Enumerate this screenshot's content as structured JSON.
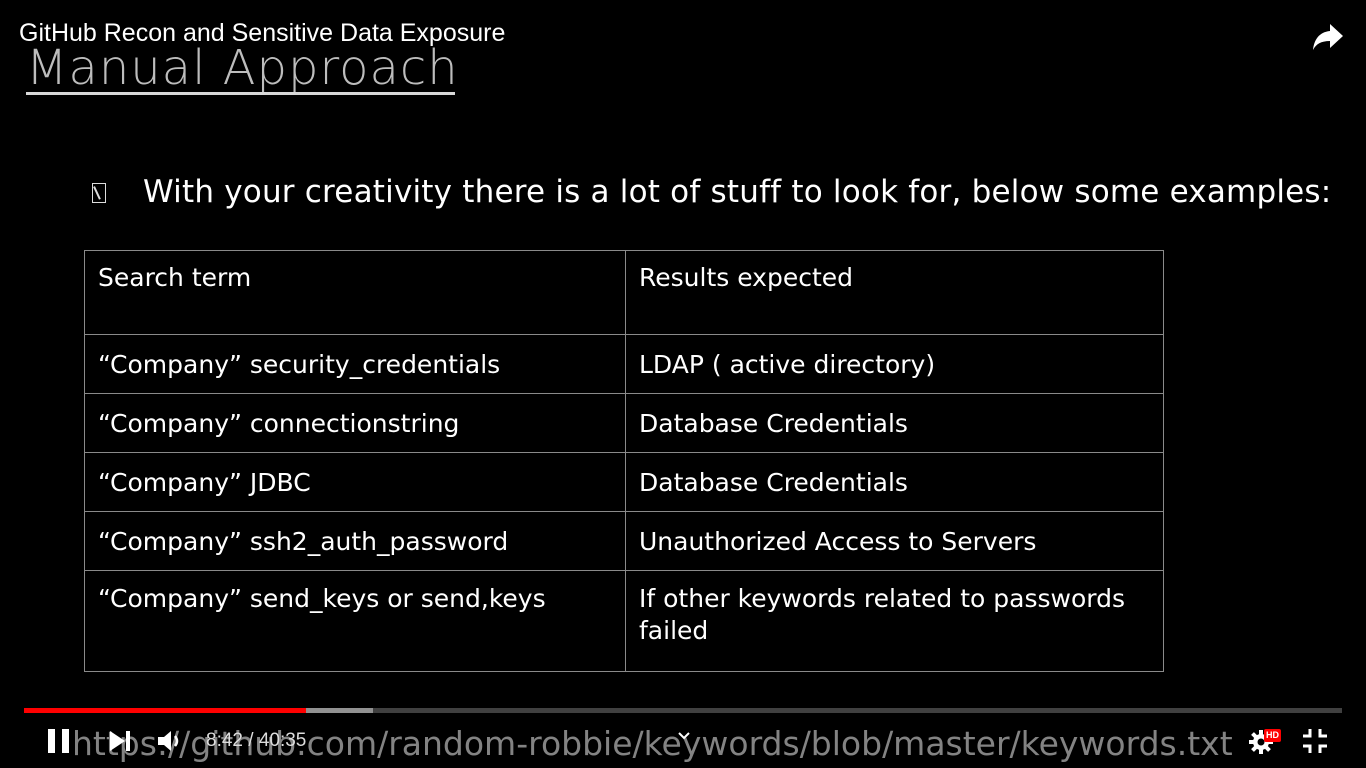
{
  "video": {
    "title": "GitHub Recon and Sensitive Data Exposure",
    "current_time": "8:42",
    "duration": "40:35",
    "time_display": "8:42 / 40:35",
    "progress_fraction": 0.214,
    "buffered_fraction": 0.265,
    "hd_badge": "HD",
    "accent_color": "#ff0000"
  },
  "slide": {
    "heading": "Manual Approach",
    "bullet_text": "With your creativity there is a lot of stuff to look for, below some examples:",
    "table": {
      "headers": [
        "Search term",
        "Results expected"
      ],
      "rows": [
        [
          "“Company” security_credentials",
          "LDAP ( active directory)"
        ],
        [
          "“Company” connectionstring",
          "Database Credentials"
        ],
        [
          "“Company” JDBC",
          "Database Credentials"
        ],
        [
          "“Company” ssh2_auth_password",
          "Unauthorized Access to Servers"
        ],
        [
          "“Company” send_keys or send,keys",
          "If other keywords related to passwords failed"
        ]
      ]
    },
    "url_overlay": "https://github.com/random-robbie/keywords/blob/master/keywords.txt"
  },
  "icons": {
    "share": "share-icon",
    "pause": "pause-icon",
    "next": "next-icon",
    "volume": "volume-icon",
    "chevron": "chevron-down-icon",
    "settings": "gear-icon",
    "fullscreen": "exit-fullscreen-icon"
  }
}
